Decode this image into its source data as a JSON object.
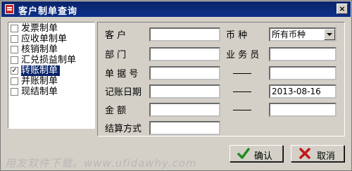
{
  "window": {
    "title": "客户制单查询",
    "close_label": "×"
  },
  "list": {
    "items": [
      {
        "label": "发票制单",
        "checked": false
      },
      {
        "label": "应收单制单",
        "checked": false
      },
      {
        "label": "核销制单",
        "checked": false
      },
      {
        "label": "汇兑损益制单",
        "checked": false
      },
      {
        "label": "转账制单",
        "checked": true,
        "selected": true
      },
      {
        "label": "并账制单",
        "checked": false
      },
      {
        "label": "现结制单",
        "checked": false
      }
    ]
  },
  "form": {
    "customer_label": "客      户",
    "department_label": "部      门",
    "doc_no_label": "单 据 号",
    "date_label": "记账日期",
    "amount_label": "金      额",
    "settlement_label": "结算方式",
    "currency_label": "币      种",
    "salesperson_label": "业 务 员",
    "currency_value": "所有币种",
    "date_value": "2013-08-16"
  },
  "buttons": {
    "ok": "确认",
    "cancel": "取消"
  },
  "watermark": "用友软件下载。www.ufidawhy.com"
}
